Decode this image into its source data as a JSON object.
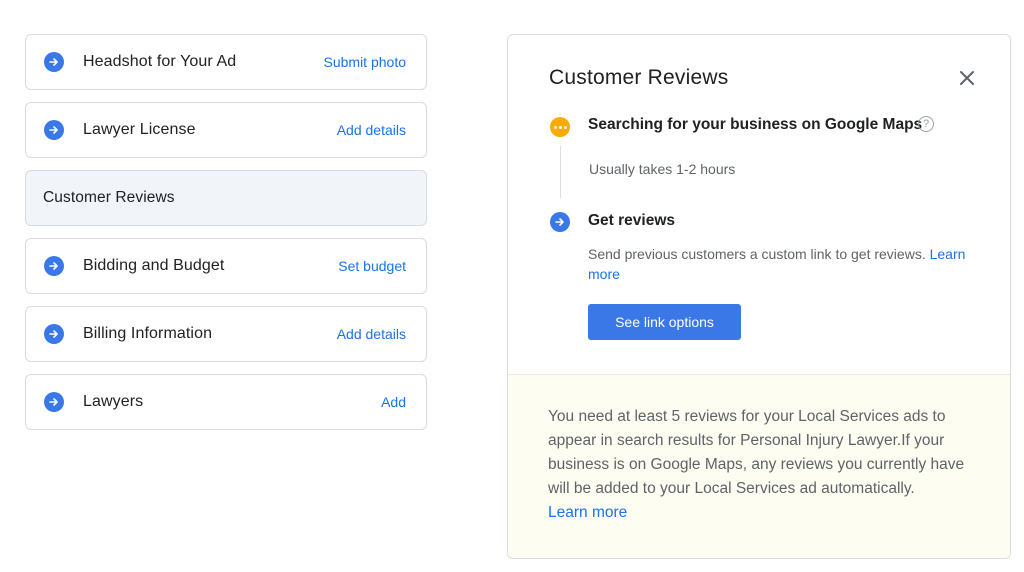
{
  "setup_list": {
    "items": [
      {
        "label": "Headshot for Your Ad",
        "action": "Submit photo"
      },
      {
        "label": "Lawyer License",
        "action": "Add details"
      },
      {
        "label": "Customer Reviews",
        "action": ""
      },
      {
        "label": "Bidding and Budget",
        "action": "Set budget"
      },
      {
        "label": "Billing Information",
        "action": "Add details"
      },
      {
        "label": "Lawyers",
        "action": "Add"
      }
    ],
    "icon": "arrow-forward-circle-icon",
    "active_index": 2
  },
  "panel": {
    "title": "Customer Reviews",
    "steps": [
      {
        "icon": "pending-dots-icon",
        "title": "Searching for your business on Google Maps",
        "description": "Usually takes 1-2 hours"
      },
      {
        "icon": "arrow-forward-circle-icon",
        "title": "Get reviews",
        "description": "Send previous customers a custom link to get reviews.",
        "link": "Learn more"
      }
    ],
    "button": "See link options",
    "notice": {
      "text": "You need at least 5 reviews for your Local Services ads to appear in search results for Personal Injury Lawyer.If your business is on Google Maps, any reviews you currently have will be added to your Local Services ad automatically.",
      "link": "Learn more"
    }
  },
  "colors": {
    "accent": "#1a73e8",
    "icon_blue": "#3b78e7",
    "pending": "#f9ab00",
    "active_bg": "#f1f4f9",
    "notice_bg": "#fefdf2"
  }
}
